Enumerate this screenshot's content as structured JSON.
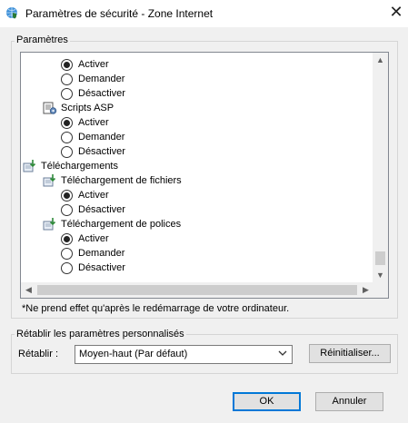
{
  "window": {
    "title": "Paramètres de sécurité - Zone Internet",
    "close_glyph": "✕",
    "icon": "globe-shield-icon"
  },
  "settings_group": {
    "label": "Paramètres",
    "tree": [
      {
        "kind": "radio",
        "label": "Activer",
        "checked": true
      },
      {
        "kind": "radio",
        "label": "Demander",
        "checked": false
      },
      {
        "kind": "radio",
        "label": "Désactiver",
        "checked": false
      },
      {
        "kind": "node",
        "label": "Scripts ASP",
        "icon": "script-settings-icon"
      },
      {
        "kind": "radio",
        "label": "Activer",
        "checked": true
      },
      {
        "kind": "radio",
        "label": "Demander",
        "checked": false
      },
      {
        "kind": "radio",
        "label": "Désactiver",
        "checked": false
      },
      {
        "kind": "node",
        "label": "Téléchargements",
        "icon": "download-settings-icon"
      },
      {
        "kind": "node",
        "label": "Téléchargement de fichiers",
        "icon": "download-settings-icon"
      },
      {
        "kind": "radio",
        "label": "Activer",
        "checked": true
      },
      {
        "kind": "radio",
        "label": "Désactiver",
        "checked": false
      },
      {
        "kind": "node",
        "label": "Téléchargement de polices",
        "icon": "download-settings-icon"
      },
      {
        "kind": "radio",
        "label": "Activer",
        "checked": true
      },
      {
        "kind": "radio",
        "label": "Demander",
        "checked": false
      },
      {
        "kind": "radio",
        "label": "Désactiver",
        "checked": false
      }
    ],
    "note": "*Ne prend effet qu'après le redémarrage de votre ordinateur."
  },
  "reset_group": {
    "label": "Rétablir les paramètres personnalisés",
    "reset_label": "Rétablir :",
    "combo_value": "Moyen-haut (Par défaut)",
    "reset_button": "Réinitialiser..."
  },
  "footer": {
    "ok": "OK",
    "cancel": "Annuler"
  },
  "colors": {
    "window_bg": "#f0f0f0",
    "list_bg": "#ffffff",
    "accent": "#0078d7"
  }
}
